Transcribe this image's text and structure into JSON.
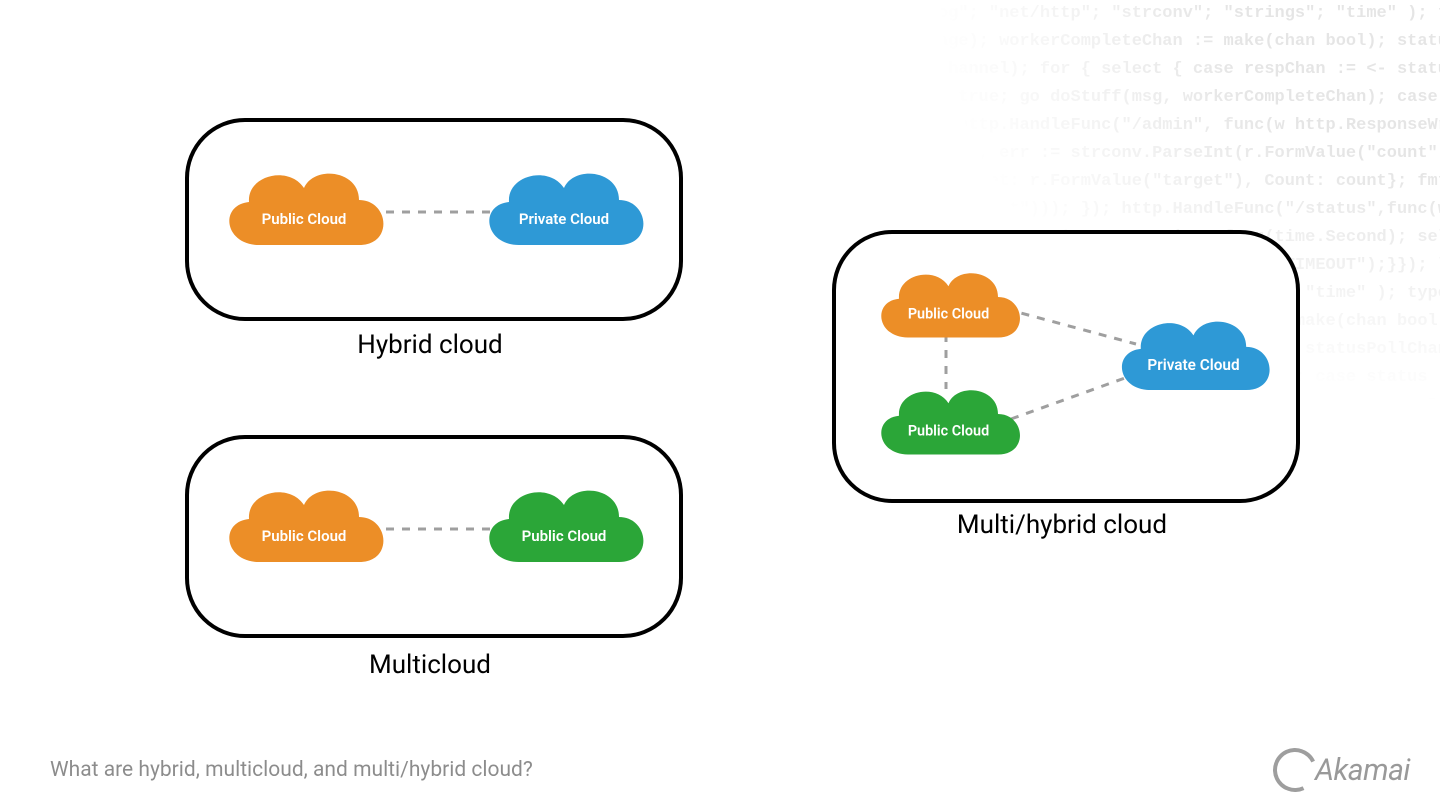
{
  "colors": {
    "orange": "#EC8E27",
    "blue": "#2E99D6",
    "green": "#2BA638"
  },
  "labels": {
    "public": "Public Cloud",
    "private": "Private Cloud"
  },
  "hybrid": {
    "title": "Hybrid cloud"
  },
  "multicloud": {
    "title": "Multicloud"
  },
  "multihybrid": {
    "title": "Multi/hybrid cloud"
  },
  "caption": "What are hybrid, multicloud, and multi/hybrid cloud?",
  "brand": "Akamai",
  "chart_data": {
    "type": "diagram-graph",
    "title": "What are hybrid, multicloud, and multi/hybrid cloud?",
    "groups": [
      {
        "name": "Hybrid cloud",
        "nodes": [
          {
            "id": "h-pub",
            "label": "Public Cloud",
            "kind": "public",
            "color": "#EC8E27"
          },
          {
            "id": "h-priv",
            "label": "Private Cloud",
            "kind": "private",
            "color": "#2E99D6"
          }
        ],
        "edges": [
          {
            "from": "h-pub",
            "to": "h-priv"
          }
        ]
      },
      {
        "name": "Multicloud",
        "nodes": [
          {
            "id": "m-pub1",
            "label": "Public Cloud",
            "kind": "public",
            "color": "#EC8E27"
          },
          {
            "id": "m-pub2",
            "label": "Public Cloud",
            "kind": "public",
            "color": "#2BA638"
          }
        ],
        "edges": [
          {
            "from": "m-pub1",
            "to": "m-pub2"
          }
        ]
      },
      {
        "name": "Multi/hybrid cloud",
        "nodes": [
          {
            "id": "mh-pub1",
            "label": "Public Cloud",
            "kind": "public",
            "color": "#EC8E27"
          },
          {
            "id": "mh-pub2",
            "label": "Public Cloud",
            "kind": "public",
            "color": "#2BA638"
          },
          {
            "id": "mh-priv",
            "label": "Private Cloud",
            "kind": "private",
            "color": "#2E99D6"
          }
        ],
        "edges": [
          {
            "from": "mh-pub1",
            "to": "mh-pub2"
          },
          {
            "from": "mh-pub1",
            "to": "mh-priv"
          },
          {
            "from": "mh-pub2",
            "to": "mh-priv"
          }
        ]
      }
    ]
  },
  "code_bg": "package main; import( \"fmt\"; \"html\"; \"log\"; \"net/http\"; \"strconv\"; \"strings\"; \"time\" ); type ControlMessage struct { Target string; Cou\ncontrolChannel := make(chan ControlMessage); workerCompleteChan := make(chan bool); statusPollChannel := make(chan chan bool); w\nworkerActive := false; go admin(controlChannel); for { select { case respChan := <- statusPollChannel: respChan <- workerActive; case \nmsg := <- controlChannel: workerActive = true; go doStuff(msg, workerCompleteChan); case status := <- workerCompleteChan: workerActive = status;\n}}; func admin(cc chan ControlMessage) { http.HandleFunc(\"/admin\", func(w http.ResponseWriter, r *http.Request) { hostTok\ntokens := strings.Split(r.Host, \":\"); count, err := strconv.ParseInt(r.FormValue(\"count\"), 10, 64); if err != nil { fmt.Fprintf(w, \n\"err\"); return; }; cc <- ControlMessage{Target: r.FormValue(\"target\"), Count: count}; fmt.Fprintf(w, \"Control message issued for Ta\nrget %s\", html.EscapeString(r.FormValue(\"target\"))); }); http.HandleFunc(\"/status\",func(w http.ResponseWriter, r *http.Request) { reqChan \n:= make(chan bool); statusPollChannel <- reqChan; timeout := time.After(time.Second); select { case result := <- reqChan: if result { fmt.Fprint(w, \"ACTIVE\"\n) } else { fmt.Fprint(w, \"INACTIVE\"); }; case <- timeout: fmt.Fprint(w, \"TIMEOUT\");}}); log.Fatal(http.ListenAndServe(\":1337\", nil)); };pac\nkage main; import( \"fmt\"; \"html\"; \"log\"; \"net/http\"; \"strconv\"; \"strings\"; \"time\" ); type ControlMessage struct { Target string; Count int64; }; func ma\nin() { controlChannel := make(chan ControlMessage); workerCompleteChan := make(chan bool); statusPollChannel := make(chan chan bool); workerAct\nive := false; go admin(controlChannel); for { select { case respChan := <- statusPollChannel: respChan <- workerActive; case msg := <\n- controlChannel: workerActive = true; go doStuff(msg, workerCompleteChan); case status := <- workerCompleteChan: workerActive = status; }}; func admin(c\nc chan ControlMessage) { http.HandleFunc(\"/admin\", func(w http.ResponseWriter, r *http.Request) { hostTokens \n:= strings.Split(r.Host, \":\"); count, err := strconv.ParseInt(r.FormValue(\"count\"), 10, 64); if err != nil { fmt.Fprintf(w, \n\"err\"); return; }; cc <- ControlMessage{Target: r.FormValue(\"target\"), Count: count}; fmt.Fprintf(w, \"Control message issued for Ta\nrget %s\", html.EscapeString(r.FormValue(\"target\"))); }); http.HandleFunc(\"/status\",func(w http.ResponseWriter, r *http.Request) { reqChan \n:= make(chan bool); statusPollChannel <- reqChan; timeout := time.After(time.Second); select { case result := <- reqChan: if result { fmt.Fprint(w, \"ACTIVE\"\n) } else { fmt.Fprint(w, \"INACTIVE\"); }; case <- timeout: fmt.Fprint(w, \"TIMEOUT\");}}); log.Fatal(http.ListenAndServe(\":1337\", nil)); };pac\nkage main; import( \"fmt\"; \"html\"; \"log\"; \"net/http\"; \"strconv\"; \"strings\"; \"time\" ); type ControlMessage struct { Target string; Count int64; }; func ma\nin() { controlChannel := make(chan ControlMessage); workerCompleteChan := make(chan bool); statusPollChannel := make(chan chan bool); workerAct\nive := false; go admin(controlChannel); for { select { case respChan := <- statusPollChannel: respChan <- workerActive; case msg := <"
}
